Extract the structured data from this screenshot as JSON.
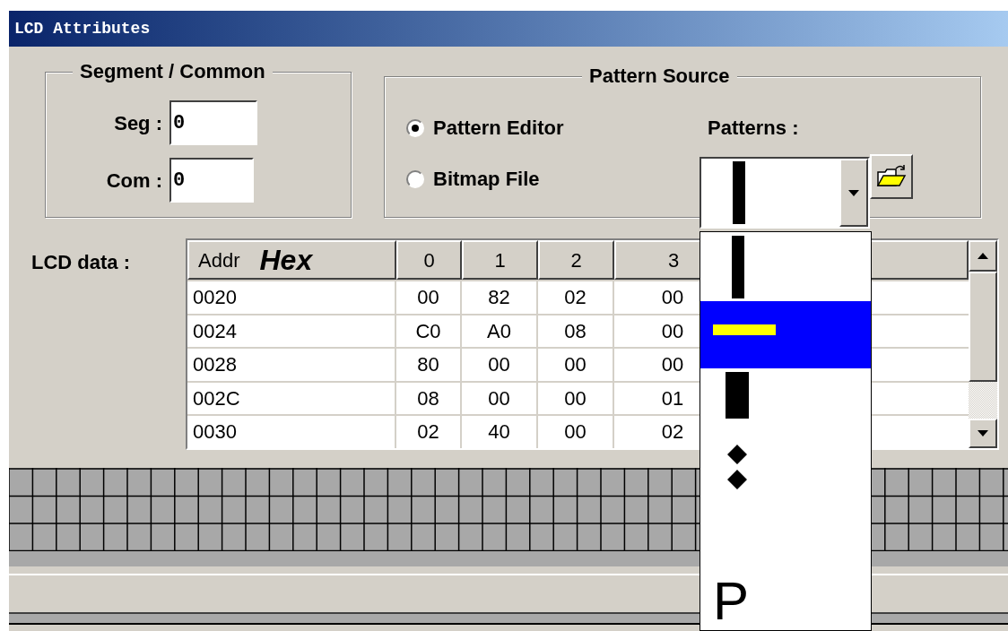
{
  "window": {
    "title": "LCD Attributes"
  },
  "segment_common": {
    "title": "Segment / Common",
    "fields": [
      {
        "label": "Seg :",
        "value": "0"
      },
      {
        "label": "Com :",
        "value": "0"
      }
    ]
  },
  "pattern_source": {
    "title": "Pattern Source",
    "options": [
      {
        "label": "Pattern Editor",
        "selected": true
      },
      {
        "label": "Bitmap File",
        "selected": false
      }
    ],
    "patterns_label": "Patterns :"
  },
  "pattern_list": [
    {
      "kind": "vbar",
      "selected": false
    },
    {
      "kind": "hbar",
      "selected": true
    },
    {
      "kind": "thick",
      "selected": false
    },
    {
      "kind": "colon",
      "selected": false
    },
    {
      "kind": "glyph",
      "text": "P",
      "selected": false
    }
  ],
  "lcd_data": {
    "label": "LCD data :",
    "columns": [
      {
        "label": "Addr",
        "unit": "Hex"
      },
      {
        "label": "0"
      },
      {
        "label": "1"
      },
      {
        "label": "2"
      },
      {
        "label": "3"
      }
    ],
    "rows": [
      [
        "0020",
        "00",
        "82",
        "02",
        "00"
      ],
      [
        "0024",
        "C0",
        "A0",
        "08",
        "00"
      ],
      [
        "0028",
        "80",
        "00",
        "00",
        "00"
      ],
      [
        "002C",
        "08",
        "00",
        "00",
        "01"
      ],
      [
        "0030",
        "02",
        "40",
        "00",
        "02"
      ]
    ]
  }
}
